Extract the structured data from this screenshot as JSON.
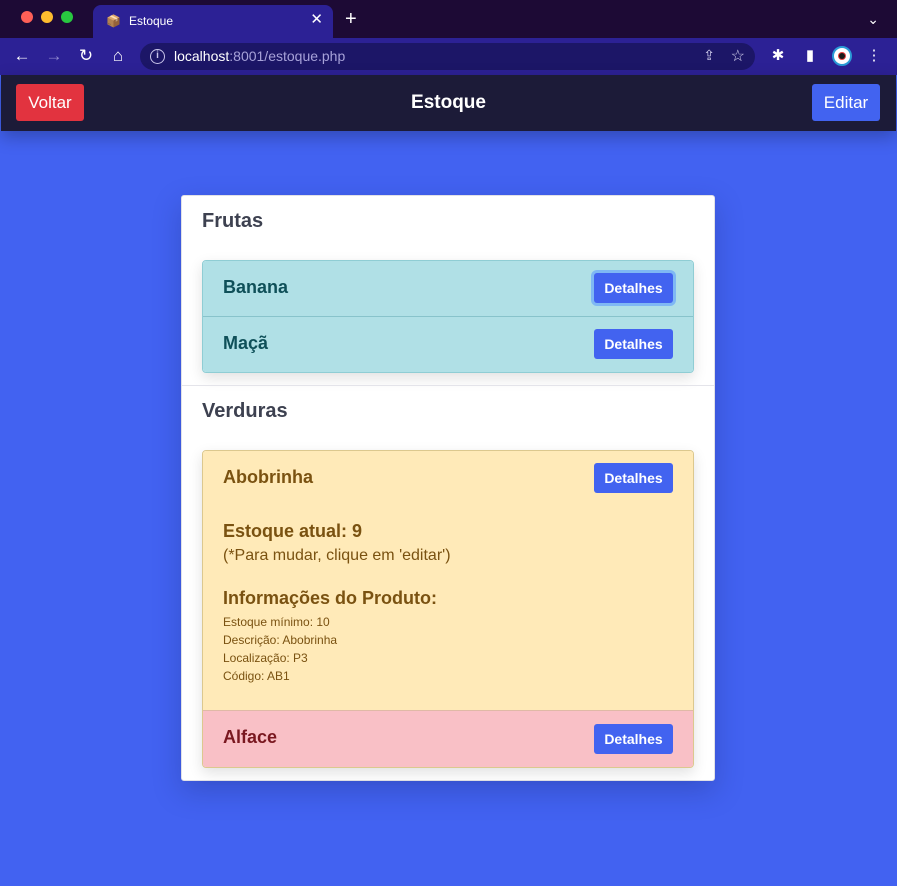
{
  "browser": {
    "tab_title": "Estoque",
    "tab_favicon": "📦",
    "tab_close": "✕",
    "new_tab": "+",
    "tab_menu": "⌄",
    "url_host": "localhost",
    "url_rest": ":8001/estoque.php",
    "icons": {
      "back": "←",
      "forward": "→",
      "reload": "↻",
      "home": "⌂",
      "info": "i",
      "share": "⇪",
      "star": "☆",
      "puzzle": "✱",
      "sidebar": "▮",
      "menu": "⋮"
    }
  },
  "header": {
    "back_label": "Voltar",
    "title": "Estoque",
    "edit_label": "Editar"
  },
  "sections": [
    {
      "title": "Frutas",
      "items": [
        {
          "name": "Banana",
          "button": "Detalhes"
        },
        {
          "name": "Maçã",
          "button": "Detalhes"
        }
      ]
    },
    {
      "title": "Verduras",
      "items": [
        {
          "name": "Abobrinha",
          "button": "Detalhes",
          "stock_title": "Estoque atual: 9",
          "stock_note": "(*Para mudar, clique em 'editar')",
          "info_title": "Informações do Produto:",
          "info": [
            "Estoque mínimo: 10",
            "Descrição: Abobrinha",
            "Localização: P3",
            "Código: AB1"
          ]
        },
        {
          "name": "Alface",
          "button": "Detalhes"
        }
      ]
    }
  ],
  "colors": {
    "page_bg": "#4262f1",
    "header_bg": "#1c1b38",
    "danger": "#e2333f",
    "primary": "#4263f0",
    "fruit_bg": "#b0e0e6",
    "vegetable_expanded_bg": "#ffeab8",
    "vegetable_alert_bg": "#f9c0c6"
  }
}
